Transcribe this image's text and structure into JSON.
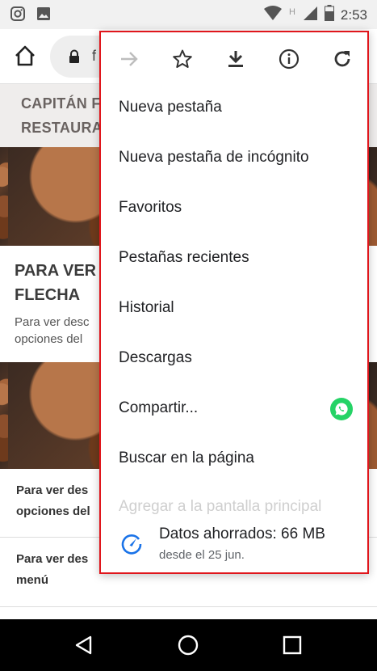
{
  "status_bar": {
    "time": "2:53",
    "network_tag": "H",
    "left_icons": [
      "instagram-icon",
      "image-icon"
    ],
    "right_icons": [
      "wifi-icon",
      "signal-icon",
      "battery-icon"
    ]
  },
  "toolbar": {
    "url_text": "f",
    "icons": [
      "home-icon",
      "lock-icon"
    ]
  },
  "page": {
    "banner_lines": [
      "CAPITÁN F",
      "RESTAURA"
    ],
    "article_title_lines": [
      "PARA VER",
      "FLECHA"
    ],
    "article_text_lines": [
      "Para ver desc",
      "opciones del"
    ],
    "list_links": [
      {
        "lines": [
          "Para ver des",
          "opciones del"
        ]
      },
      {
        "lines": [
          "Para ver des",
          "menú"
        ]
      }
    ]
  },
  "menu": {
    "icons": [
      "forward-icon",
      "bookmark-star-icon",
      "download-icon",
      "info-icon",
      "refresh-icon"
    ],
    "items": [
      {
        "label": "Nueva pestaña"
      },
      {
        "label": "Nueva pestaña de incógnito"
      },
      {
        "label": "Favoritos"
      },
      {
        "label": "Pestañas recientes"
      },
      {
        "label": "Historial"
      },
      {
        "label": "Descargas"
      },
      {
        "label": "Compartir..."
      },
      {
        "label": "Buscar en la página"
      },
      {
        "label": "Agregar a la pantalla principal"
      }
    ],
    "share_app_icon": "whatsapp-icon",
    "data_saved": {
      "title": "Datos ahorrados: 66 MB",
      "subtitle": "desde el 25 jun.",
      "icon": "data-saver-gauge-icon"
    }
  },
  "nav_bar": {
    "icons": [
      "back-icon",
      "home-circle-icon",
      "recents-icon"
    ]
  },
  "colors": {
    "menu_border": "#e0161c",
    "accent_blue": "#1a73e8",
    "whatsapp_green": "#25d366"
  }
}
